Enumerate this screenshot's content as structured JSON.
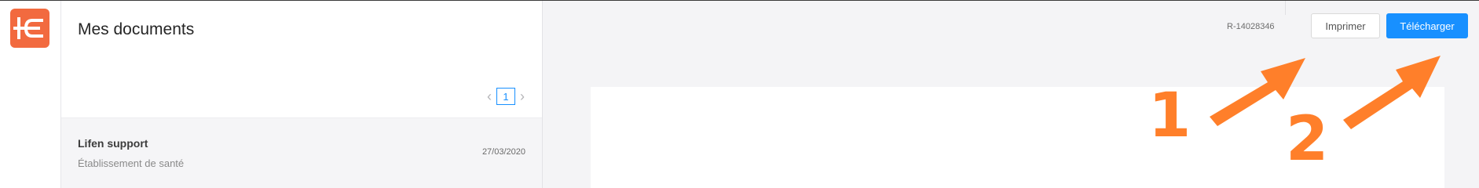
{
  "brand": {
    "color": "#f26a3f",
    "icon": "lifen-logo-icon"
  },
  "panel": {
    "title": "Mes documents",
    "pagination": {
      "current_page": "1",
      "prev_icon": "chevron-left-icon",
      "next_icon": "chevron-right-icon"
    },
    "documents": [
      {
        "sender": "Lifen support",
        "type": "Établissement de santé",
        "date": "27/03/2020"
      }
    ]
  },
  "viewer": {
    "reference": "R-14028346",
    "print_label": "Imprimer",
    "download_label": "Télécharger",
    "accent_color": "#1890ff"
  },
  "annotations": {
    "color": "#ff7f2a",
    "labels": [
      "1",
      "2"
    ]
  }
}
